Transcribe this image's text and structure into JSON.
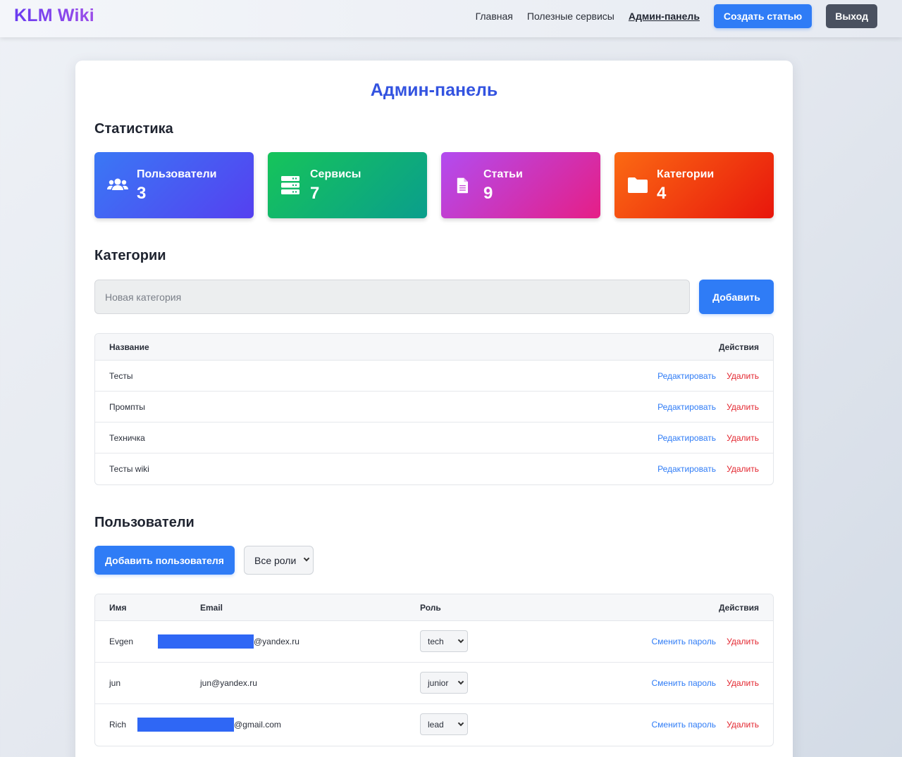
{
  "header": {
    "logo": "KLM Wiki",
    "nav": [
      "Главная",
      "Полезные сервисы",
      "Админ-панель"
    ],
    "create_label": "Создать статью",
    "logout_label": "Выход"
  },
  "page": {
    "title": "Админ-панель",
    "stats_title": "Статистика",
    "categories_title": "Категории",
    "users_title": "Пользователи"
  },
  "stats": [
    {
      "label": "Пользователи",
      "value": "3",
      "icon": "users-icon"
    },
    {
      "label": "Сервисы",
      "value": "7",
      "icon": "server-icon"
    },
    {
      "label": "Статьи",
      "value": "9",
      "icon": "document-icon"
    },
    {
      "label": "Категории",
      "value": "4",
      "icon": "folder-icon"
    }
  ],
  "categories": {
    "input_placeholder": "Новая категория",
    "add_label": "Добавить",
    "col_name": "Название",
    "col_actions": "Действия",
    "edit_label": "Редактировать",
    "delete_label": "Удалить",
    "rows": [
      "Тесты",
      "Промпты",
      "Техничка",
      "Тесты wiki"
    ]
  },
  "users": {
    "add_label": "Добавить пользователя",
    "role_filter": "Все роли",
    "col_name": "Имя",
    "col_email": "Email",
    "col_role": "Роль",
    "col_actions": "Действия",
    "change_pw_label": "Сменить пароль",
    "delete_label": "Удалить",
    "rows": [
      {
        "name": "Evgen",
        "email": "@yandex.ru",
        "role": "tech",
        "redacted": true
      },
      {
        "name": "jun",
        "email": "jun@yandex.ru",
        "role": "junior",
        "redacted": false
      },
      {
        "name": "Rich",
        "email": "@gmail.com",
        "role": "lead",
        "redacted": true
      }
    ]
  },
  "colors": {
    "accent": "#2f7cf6",
    "title": "#3353e0",
    "danger": "#e3262f",
    "redaction": "#2f67f5"
  }
}
